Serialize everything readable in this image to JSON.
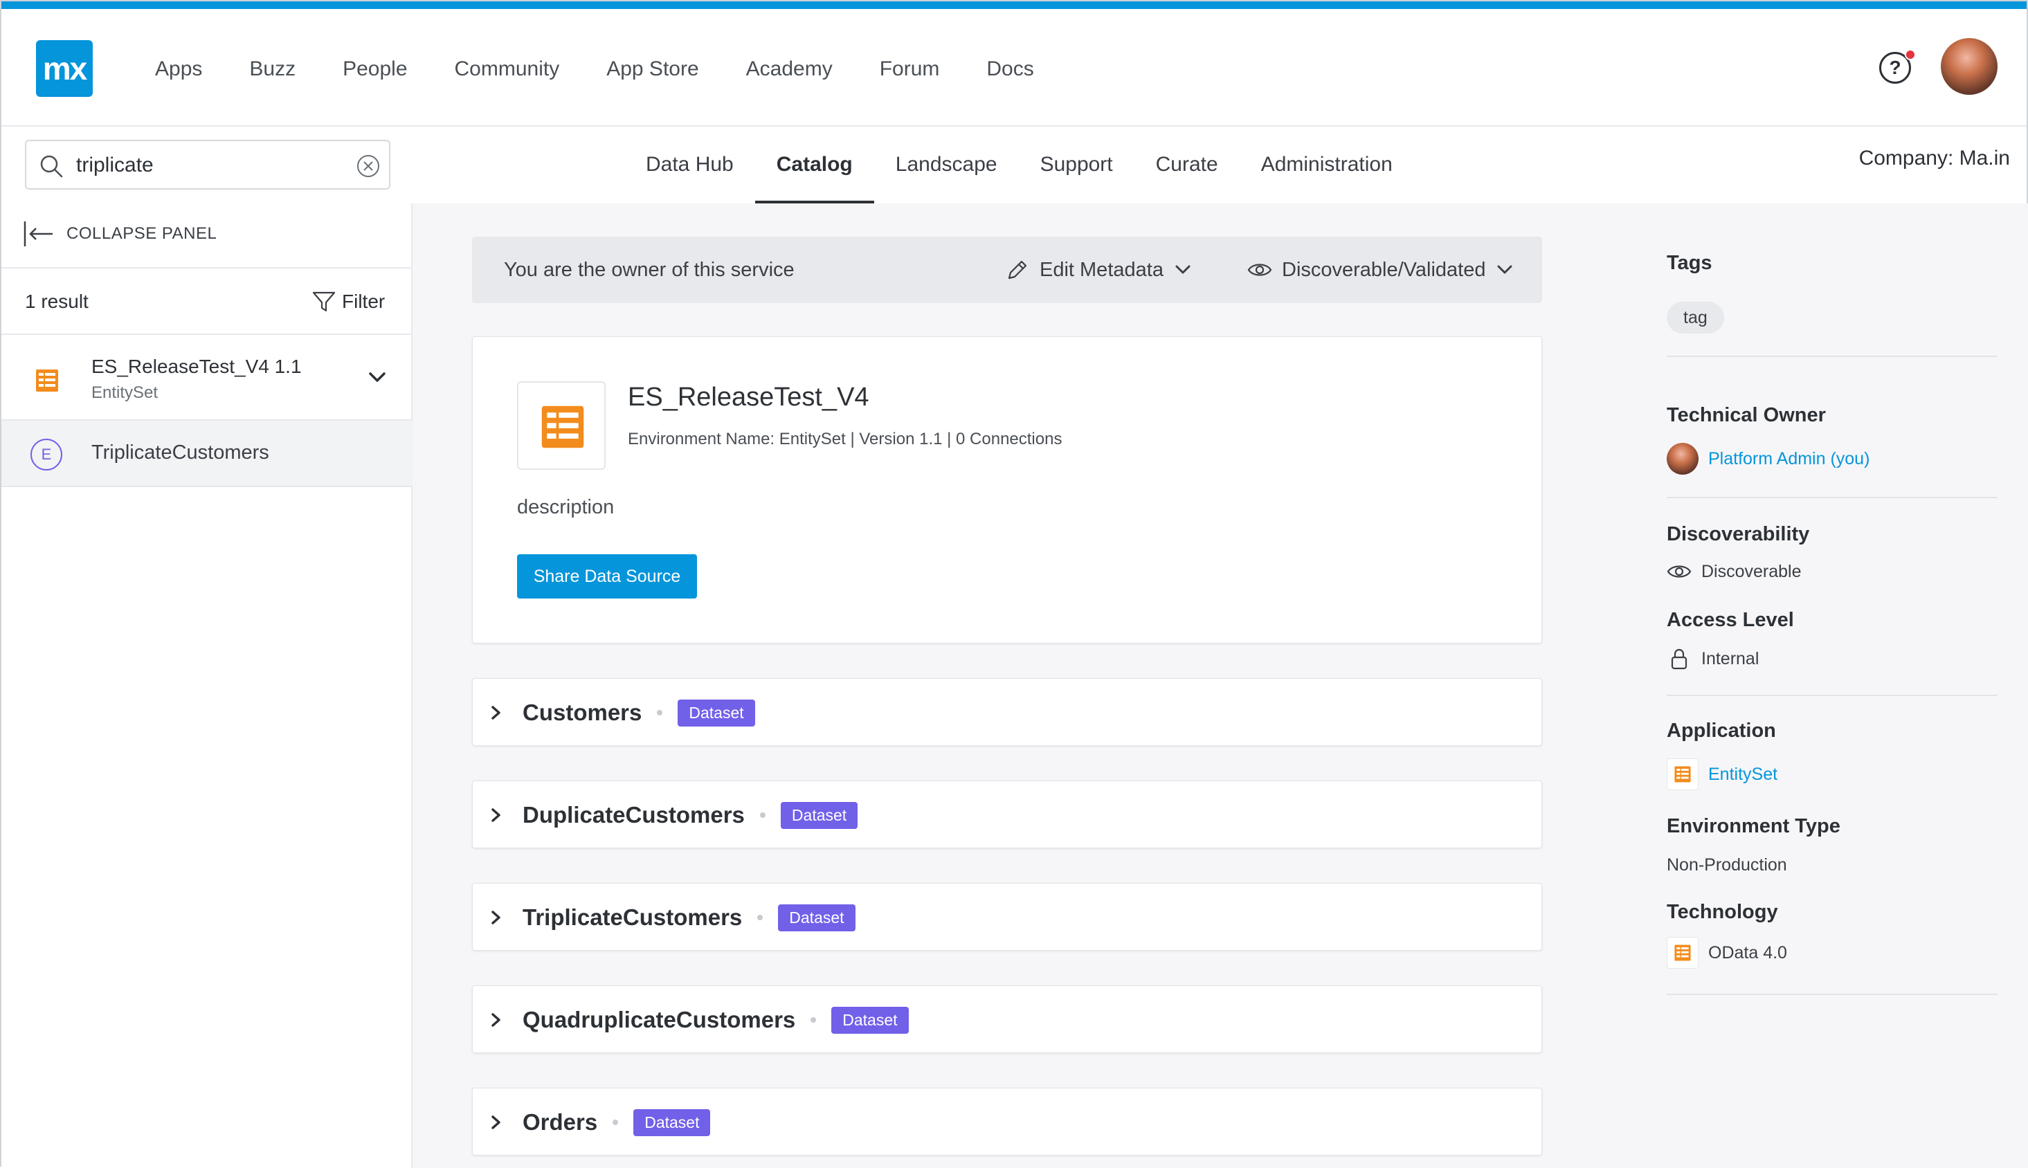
{
  "brand": {
    "logo_text": "mx",
    "accent": "#0595db"
  },
  "main_nav": [
    "Apps",
    "Buzz",
    "People",
    "Community",
    "App Store",
    "Academy",
    "Forum",
    "Docs"
  ],
  "help": {
    "label": "?"
  },
  "search": {
    "value": "triplicate"
  },
  "sub_nav": {
    "tabs": [
      "Data Hub",
      "Catalog",
      "Landscape",
      "Support",
      "Curate",
      "Administration"
    ],
    "active": "Catalog"
  },
  "company": "Company:  Ma.in",
  "left_panel": {
    "collapse_label": "COLLAPSE PANEL",
    "results_count": "1 result",
    "filter_label": "Filter",
    "result": {
      "name": "ES_ReleaseTest_V4 1.1",
      "type": "EntitySet"
    },
    "entity": {
      "badge": "E",
      "name": "TriplicateCustomers"
    }
  },
  "owner_bar": {
    "text": "You are the owner of this service",
    "edit_label": "Edit Metadata",
    "discover_label": "Discoverable/Validated"
  },
  "service": {
    "title": "ES_ReleaseTest_V4",
    "meta": "Environment Name: EntitySet | Version 1.1 | 0 Connections",
    "description": "description",
    "share_label": "Share Data Source"
  },
  "datasets": [
    {
      "name": "Customers",
      "badge": "Dataset"
    },
    {
      "name": "DuplicateCustomers",
      "badge": "Dataset"
    },
    {
      "name": "TriplicateCustomers",
      "badge": "Dataset"
    },
    {
      "name": "QuadruplicateCustomers",
      "badge": "Dataset"
    },
    {
      "name": "Orders",
      "badge": "Dataset"
    }
  ],
  "right_panel": {
    "tags_heading": "Tags",
    "tag": "tag",
    "owner_heading": "Technical Owner",
    "owner_name": "Platform Admin (you)",
    "discover_heading": "Discoverability",
    "discover_value": "Discoverable",
    "access_heading": "Access Level",
    "access_value": "Internal",
    "app_heading": "Application",
    "app_value": "EntitySet",
    "env_heading": "Environment Type",
    "env_value": "Non-Production",
    "tech_heading": "Technology",
    "tech_value": "OData 4.0"
  },
  "colors": {
    "badge": "#7160e8",
    "icon_orange": "#f28c1c",
    "link": "#0595db"
  }
}
